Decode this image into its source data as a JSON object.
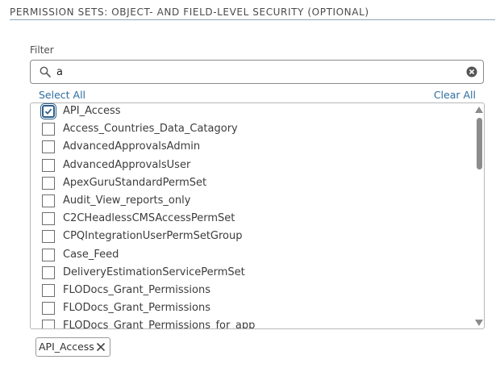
{
  "section": {
    "title": "PERMISSION SETS: OBJECT- AND FIELD-LEVEL SECURITY (OPTIONAL)"
  },
  "filter": {
    "label": "Filter",
    "value": "a",
    "search_icon": "search-icon",
    "clear_icon": "clear-circle-icon"
  },
  "actions": {
    "select_all": "Select All",
    "clear_all": "Clear All"
  },
  "list": {
    "items": [
      {
        "label": "API_Access",
        "checked": true
      },
      {
        "label": "Access_Countries_Data_Catagory",
        "checked": false
      },
      {
        "label": "AdvancedApprovalsAdmin",
        "checked": false
      },
      {
        "label": "AdvancedApprovalsUser",
        "checked": false
      },
      {
        "label": "ApexGuruStandardPermSet",
        "checked": false
      },
      {
        "label": "Audit_View_reports_only",
        "checked": false
      },
      {
        "label": "C2CHeadlessCMSAccessPermSet",
        "checked": false
      },
      {
        "label": "CPQIntegrationUserPermSetGroup",
        "checked": false
      },
      {
        "label": "Case_Feed",
        "checked": false
      },
      {
        "label": "DeliveryEstimationServicePermSet",
        "checked": false
      },
      {
        "label": "FLODocs_Grant_Permissions",
        "checked": false
      },
      {
        "label": "FLODocs_Grant_Permissions",
        "checked": false
      },
      {
        "label": "FLODocs_Grant_Permissions_for_app",
        "checked": false
      }
    ]
  },
  "selected": {
    "pills": [
      {
        "label": "API_Access"
      }
    ]
  },
  "colors": {
    "link": "#2e6c9e",
    "checked_border": "#2f5f8a",
    "rule": "#8fa7bd"
  }
}
